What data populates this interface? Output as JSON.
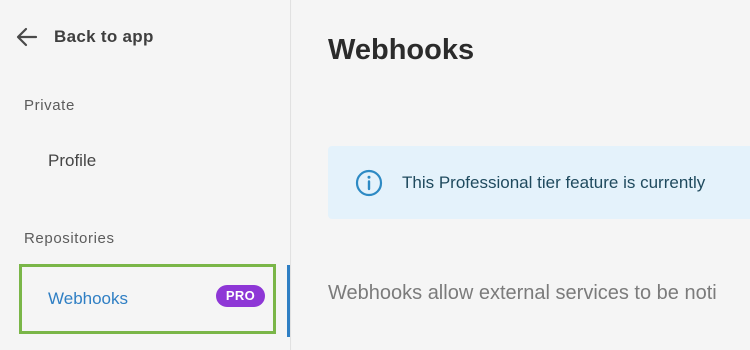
{
  "sidebar": {
    "back_label": "Back to app",
    "sections": [
      {
        "label": "Private",
        "items": [
          {
            "label": "Profile"
          }
        ]
      },
      {
        "label": "Repositories",
        "items": [
          {
            "label": "Webhooks",
            "badge": "PRO",
            "active": true
          }
        ]
      }
    ]
  },
  "main": {
    "title": "Webhooks",
    "info_banner": {
      "icon": "info-icon",
      "text": "This Professional tier feature is currently"
    },
    "description": "Webhooks allow external services to be noti"
  },
  "colors": {
    "accent": "#2f7fc4",
    "pro_badge": "#8e37d6",
    "highlight_border": "#7ab648",
    "info_background": "#e4f2fb"
  }
}
